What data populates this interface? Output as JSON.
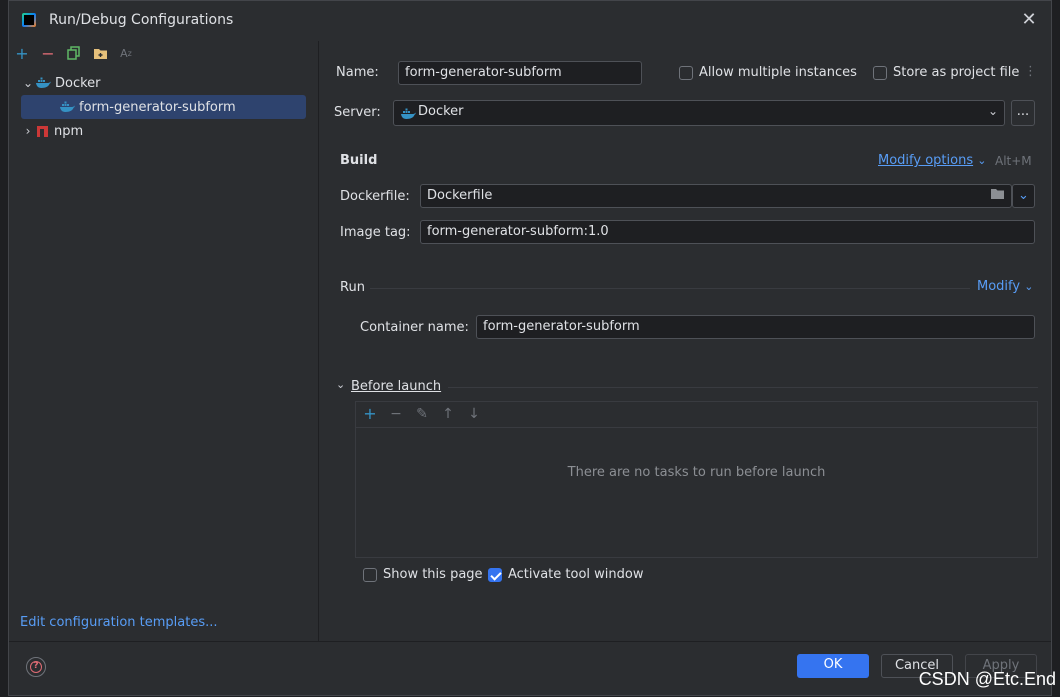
{
  "window": {
    "title": "Run/Debug Configurations"
  },
  "left_toolbar": {
    "add": "+",
    "remove": "−",
    "copy_icon": "copy-icon",
    "folder_icon": "new-folder-icon",
    "sort_icon": "sort-icon"
  },
  "tree": {
    "docker": {
      "label": "Docker"
    },
    "docker_child": {
      "label": "form-generator-subform"
    },
    "npm": {
      "label": "npm"
    }
  },
  "edit_templates": "Edit configuration templates...",
  "form": {
    "name_label": "Name:",
    "name_value": "form-generator-subform",
    "allow_multiple": "Allow multiple instances",
    "store_project": "Store as project file",
    "server_label": "Server:",
    "server_value": "Docker",
    "browse": "...",
    "build_heading": "Build",
    "modify_options": "Modify options",
    "modify_shortcut": "Alt+M",
    "dockerfile_label": "Dockerfile:",
    "dockerfile_value": "Dockerfile",
    "image_tag_label": "Image tag:",
    "image_tag_value": "form-generator-subform:1.0",
    "run_heading": "Run",
    "modify": "Modify",
    "container_label": "Container name:",
    "container_value": "form-generator-subform",
    "before_launch": "Before launch",
    "no_tasks": "There are no tasks to run before launch",
    "show_page": "Show this page",
    "activate_tool": "Activate tool window"
  },
  "footer": {
    "ok": "OK",
    "cancel": "Cancel",
    "apply": "Apply"
  },
  "watermark": "CSDN @Etc.End",
  "colors": {
    "accent": "#3574f0",
    "link": "#589df6",
    "background": "#2b2d30"
  }
}
